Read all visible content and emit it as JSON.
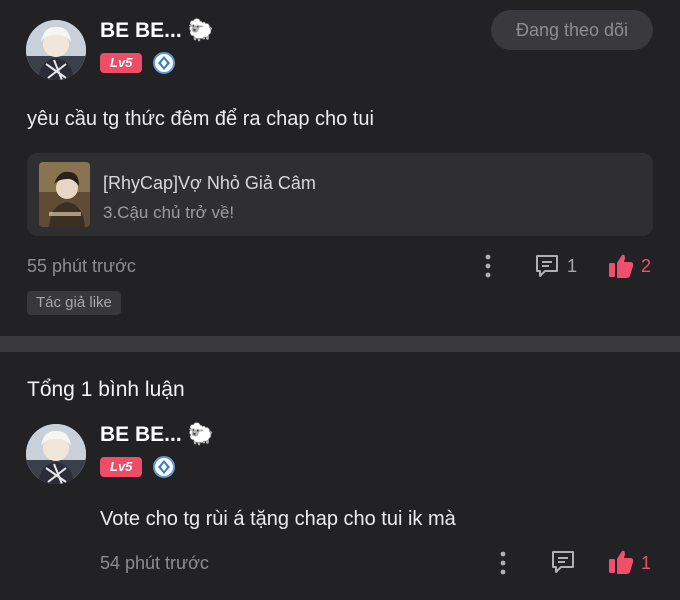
{
  "post": {
    "user_name": "BE BE...",
    "level": "Lv5",
    "follow_label": "Đang theo dõi",
    "content": "yêu cầu tg thức đêm để ra chap cho tui",
    "card": {
      "title": "[RhyCap]Vợ Nhỏ Giả Câm",
      "subtitle": "3.Cậu chủ trở về!"
    },
    "time": "55 phút trước",
    "comment_count": "1",
    "like_count": "2",
    "tag": "Tác giả like"
  },
  "comments_header": "Tổng 1 bình luận",
  "comment": {
    "user_name": "BE BE...",
    "level": "Lv5",
    "content": "Vote cho tg rùi á tặng chap cho tui ik mà",
    "time": "54 phút trước",
    "like_count": "1"
  },
  "colors": {
    "background": "#222224",
    "accent": "#f0506e",
    "level_badge": "#ee4d68"
  }
}
